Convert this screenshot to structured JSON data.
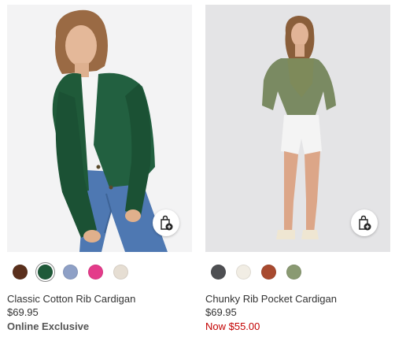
{
  "products": [
    {
      "name": "Classic Cotton Rib Cardigan",
      "price": "$69.95",
      "badge": "Online Exclusive",
      "swatches": [
        "#5a2f1c",
        "#1f5a39",
        "#8ea0c6",
        "#e43b8a",
        "#e6ded3"
      ]
    },
    {
      "name": "Chunky Rib Pocket Cardigan",
      "price": "$69.95",
      "sale_price": "Now $55.00",
      "swatches": [
        "#4e4f52",
        "#f1ede4",
        "#a84a2f",
        "#8a9a72"
      ]
    }
  ],
  "icons": {
    "quick_add": "shopping-bag-plus-icon"
  }
}
